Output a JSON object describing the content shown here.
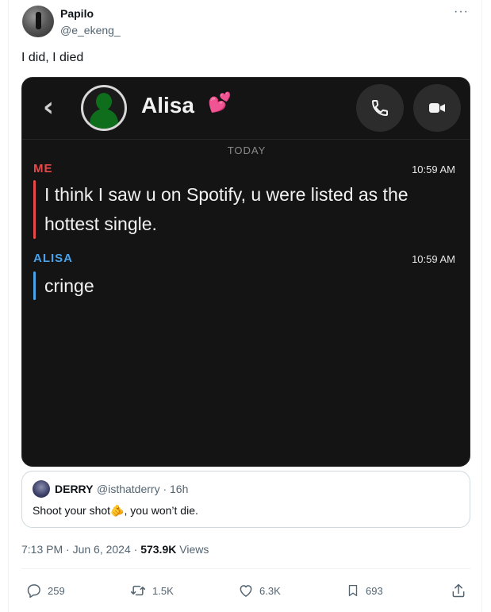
{
  "author": {
    "name": "Papilo",
    "handle": "@e_ekeng_"
  },
  "tweet": {
    "text": "I did, I died"
  },
  "chat": {
    "contact_name": "Alisa",
    "heart_emoji": "💕",
    "date_divider": "TODAY",
    "messages": [
      {
        "sender": "ME",
        "time": "10:59 AM",
        "text": "I think I saw u on Spotify, u were listed as the hottest single.",
        "color": "#e8484a"
      },
      {
        "sender": "ALISA",
        "time": "10:59 AM",
        "text": "cringe",
        "color": "#4aa3ea"
      }
    ]
  },
  "quote": {
    "name": "DERRY",
    "handle_time": "@isthatderry · 16h",
    "text": "Shoot your shot🫵, you won’t die."
  },
  "meta": {
    "time_date": "7:13 PM · Jun 6, 2024 · ",
    "views_count": "573.9K",
    "views_label": " Views"
  },
  "actions": {
    "replies": "259",
    "reposts": "1.5K",
    "likes": "6.3K",
    "bookmarks": "693"
  },
  "colors": {
    "text_primary": "#0f1419",
    "text_secondary": "#536471",
    "chat_bg": "#141414"
  }
}
